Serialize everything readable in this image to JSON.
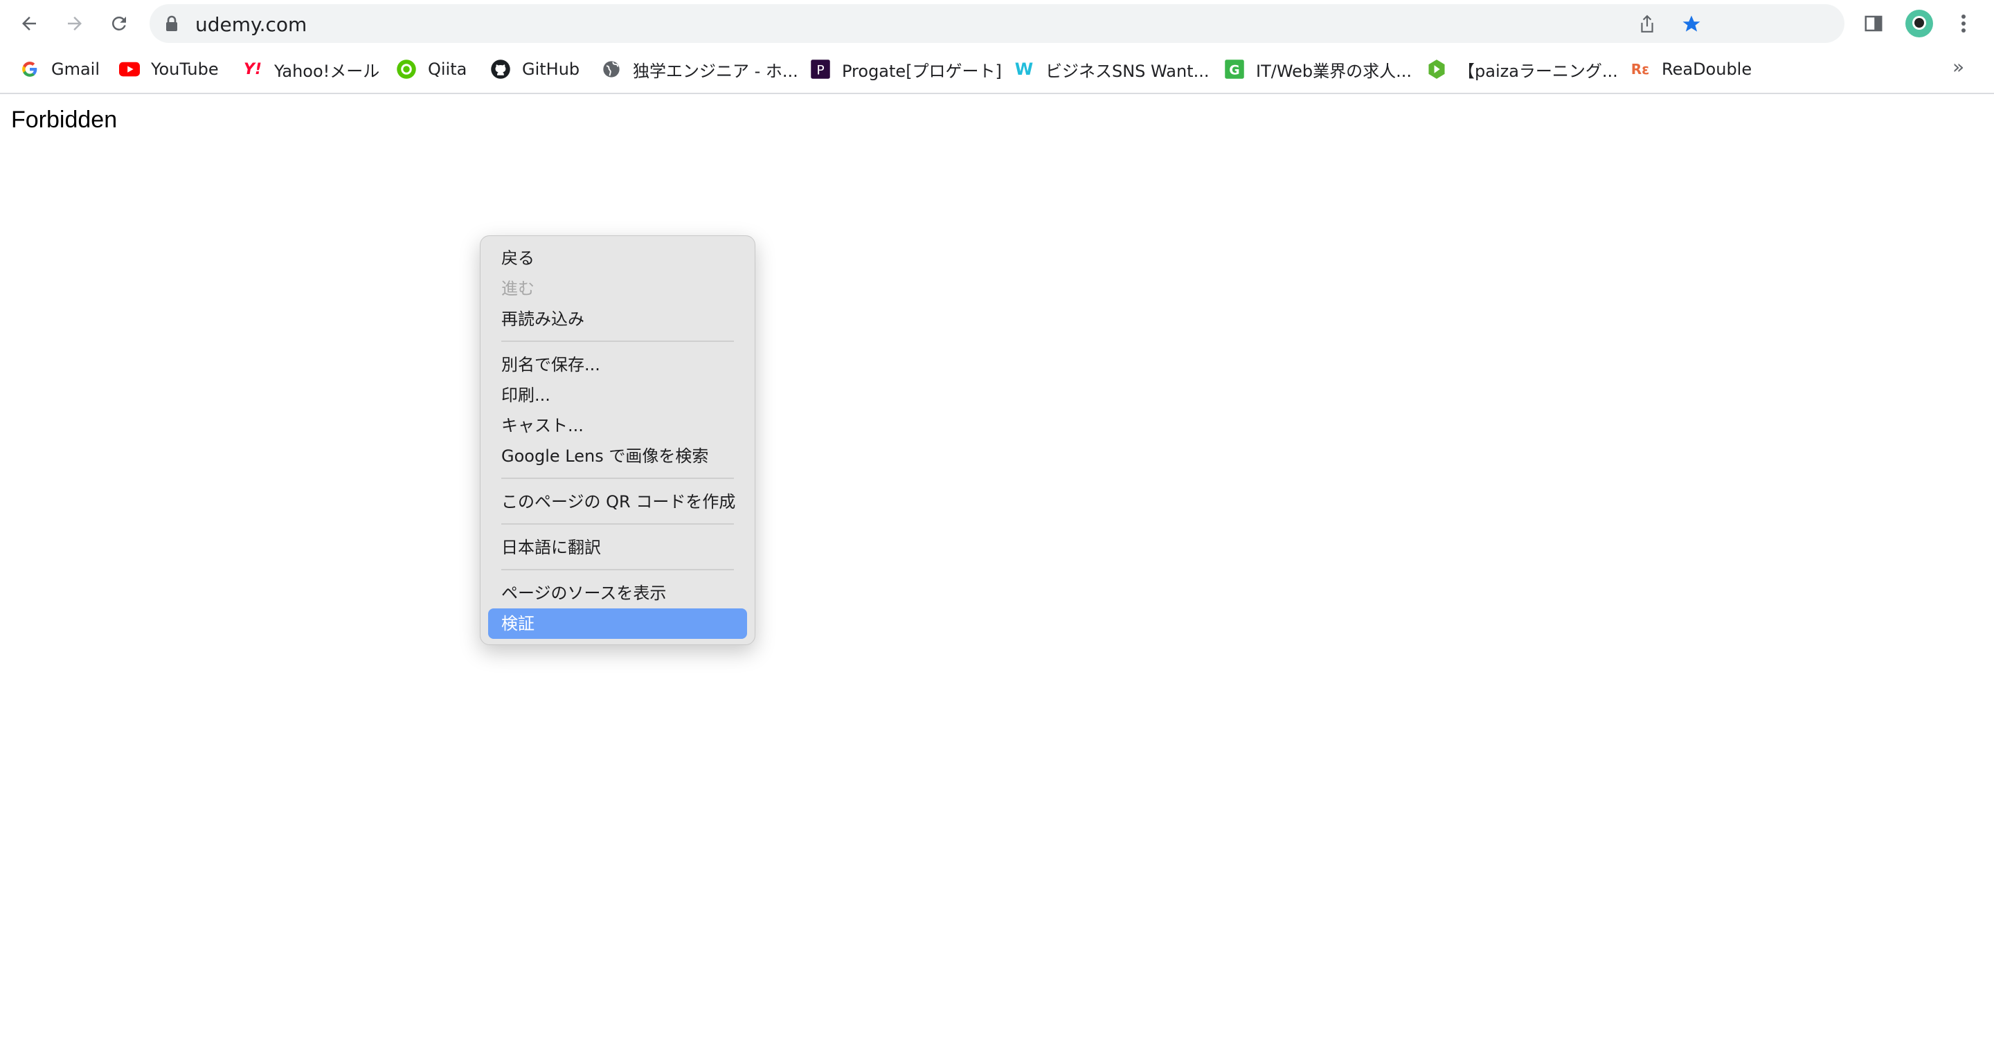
{
  "browser": {
    "url": "udemy.com"
  },
  "bookmarks": [
    {
      "label": "Gmail",
      "icon": "google-g-icon"
    },
    {
      "label": "YouTube",
      "icon": "youtube-icon"
    },
    {
      "label": "Yahoo!メール",
      "icon": "yahoo-icon"
    },
    {
      "label": "Qiita",
      "icon": "qiita-icon"
    },
    {
      "label": "GitHub",
      "icon": "github-icon"
    },
    {
      "label": "独学エンジニア - ホ...",
      "icon": "globe-icon"
    },
    {
      "label": "Progate[プロゲート]",
      "icon": "progate-icon"
    },
    {
      "label": "ビジネスSNS Want...",
      "icon": "wantedly-icon"
    },
    {
      "label": "IT/Web業界の求人...",
      "icon": "green-icon"
    },
    {
      "label": "【paizaラーニング...",
      "icon": "paiza-icon"
    },
    {
      "label": "ReaDouble",
      "icon": "readouble-icon"
    }
  ],
  "page": {
    "text": "Forbidden"
  },
  "context_menu": {
    "items": [
      {
        "label": "戻る",
        "enabled": true
      },
      {
        "label": "進む",
        "enabled": false
      },
      {
        "label": "再読み込み",
        "enabled": true
      },
      {
        "label": "別名で保存...",
        "enabled": true
      },
      {
        "label": "印刷...",
        "enabled": true
      },
      {
        "label": "キャスト...",
        "enabled": true
      },
      {
        "label": "Google Lens で画像を検索",
        "enabled": true
      },
      {
        "label": "このページの QR コードを作成",
        "enabled": true
      },
      {
        "label": "日本語に翻訳",
        "enabled": true
      },
      {
        "label": "ページのソースを表示",
        "enabled": true
      },
      {
        "label": "検証",
        "enabled": true,
        "highlighted": true
      }
    ]
  },
  "colors": {
    "highlight": "#6ba0f7",
    "bookmark_star": "#1a73e8"
  }
}
